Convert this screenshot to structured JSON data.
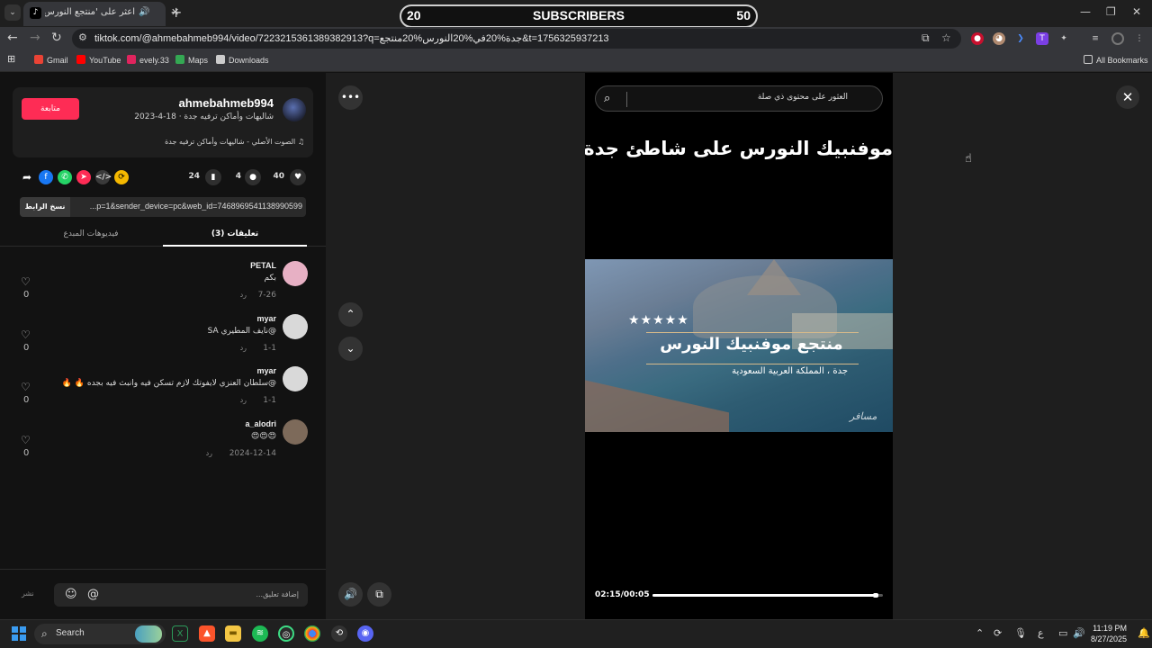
{
  "browser": {
    "tab_title": "اعثر على 'منتجع النورس في",
    "tab_favicon": "tiktok-icon",
    "new_tab_label": "+",
    "url": "tiktok.com/@ahmebahmeb994/video/7223215361389382913?q=جدة%20في%20النورس%20منتجع&t=1756325937213",
    "bookmarks": [
      {
        "label": "Gmail",
        "color": "#ea4335"
      },
      {
        "label": "YouTube",
        "color": "#ff0000"
      },
      {
        "label": "evely.33",
        "color": "#e0245e"
      },
      {
        "label": "Maps",
        "color": "#34a853"
      },
      {
        "label": "Downloads",
        "color": "#cccccc"
      }
    ],
    "all_bookmarks": "All Bookmarks"
  },
  "subscriber_bar": {
    "start": "20",
    "label": "SUBSCRIBERS",
    "end": "50",
    "progress": 0
  },
  "author": {
    "follow_label": "متابعة",
    "username": "ahmebahmeb994",
    "meta": "شاليهات وأماكن ترفيه جدة · 18-4-2023",
    "sound": "الصوت الأصلي - شاليهات وأماكن ترفيه جدة"
  },
  "stats": {
    "likes": "40",
    "comments": "4",
    "saves": "24"
  },
  "share_link": {
    "copy_label": "نسخ الرابط",
    "text": "...p=1&sender_device=pc&web_id=7468969541138990599"
  },
  "tabs": {
    "comments": "تعليقات (3)",
    "creator_videos": "فيديوهات المبدع"
  },
  "comments": [
    {
      "user": "PETAL",
      "text": "بكم",
      "date": "7-26",
      "reply": "رد",
      "likes": "0",
      "avatar_color": "#e7b0c4"
    },
    {
      "user": "myar",
      "text": "@نايف المطيري SA",
      "date": "1-1",
      "reply": "رد",
      "likes": "0",
      "avatar_color": "#d9d9d9"
    },
    {
      "user": "myar",
      "text": "@سلطان العنزي لايفوتك لازم تسكن فيه وانبث فيه بجده 🔥 🔥",
      "date": "1-1",
      "reply": "رد",
      "likes": "0",
      "avatar_color": "#d9d9d9"
    },
    {
      "user": "a_alodri",
      "text": "😍😍😍",
      "date": "2024-12-14",
      "reply": "رد",
      "likes": "0",
      "avatar_color": "#7d6a5a"
    }
  ],
  "composer": {
    "placeholder": "إضافة تعليق...",
    "post_label": "نشر"
  },
  "player": {
    "search_placeholder": "العثور على محتوى ذي صلة",
    "video_title": "موفنبيك النورس على شاطئ جدة",
    "stars": "★★★★★",
    "resort_name": "منتجع موفنبيك النورس",
    "resort_location": "جدة ، المملكة العربية السعودية",
    "watermark": "مسافر",
    "time": "02:15/00:05",
    "progress": 0.98
  },
  "taskbar": {
    "search_label": "Search",
    "time": "11:19 PM",
    "date": "8/27/2025",
    "lang": "ع"
  }
}
